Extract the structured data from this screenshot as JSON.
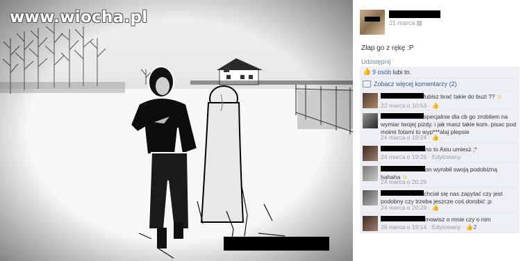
{
  "watermark": "www.wiocha.pl",
  "post": {
    "date": "21 marca",
    "text": "Złap go z rękę :P",
    "share": "Udostępnij",
    "likes_link": "9 osób",
    "likes_rest": " lubi to.",
    "more_comments": "Zobacz więcej komentarzy (2)"
  },
  "comments": [
    {
      "text": "lubisz brać takie do buzi ?? ",
      "emoji": "☺",
      "time": "22 marca o 10:53",
      "extra": " · ",
      "like_icon": "thumb-icon"
    },
    {
      "text": "specjalnie dla cb go zrobilem na wymiar twojej pizdy. i jak masz takie kom. pisac pod moimi fotami to wyp***alaj plepsie",
      "time": "24 marca o 19:24",
      "extra": " · "
    },
    {
      "text": "no to Asiu umiesz ;*",
      "time": "24 marca o 19:26",
      "extra": " · Edytowany"
    },
    {
      "text": "on wyrobił swoją podobizną hahaha ",
      "emoji": "☺",
      "time": "24 marca o 20:29",
      "extra": ""
    },
    {
      "text": "chciał się nas zapytać czy jest podobny czy trzeba jeszcze coś dorobić ;p",
      "time": "24 marca o 20:29",
      "extra": " · "
    },
    {
      "text": "mowisz o mnie czy o nim",
      "time": "26 marca o 19:14",
      "extra": " · Edytowany · ",
      "like_count": "2"
    }
  ],
  "colors": {
    "panel_bg": "#ffffff",
    "comment_bg": "#edeff4",
    "link": "#3b5998"
  }
}
